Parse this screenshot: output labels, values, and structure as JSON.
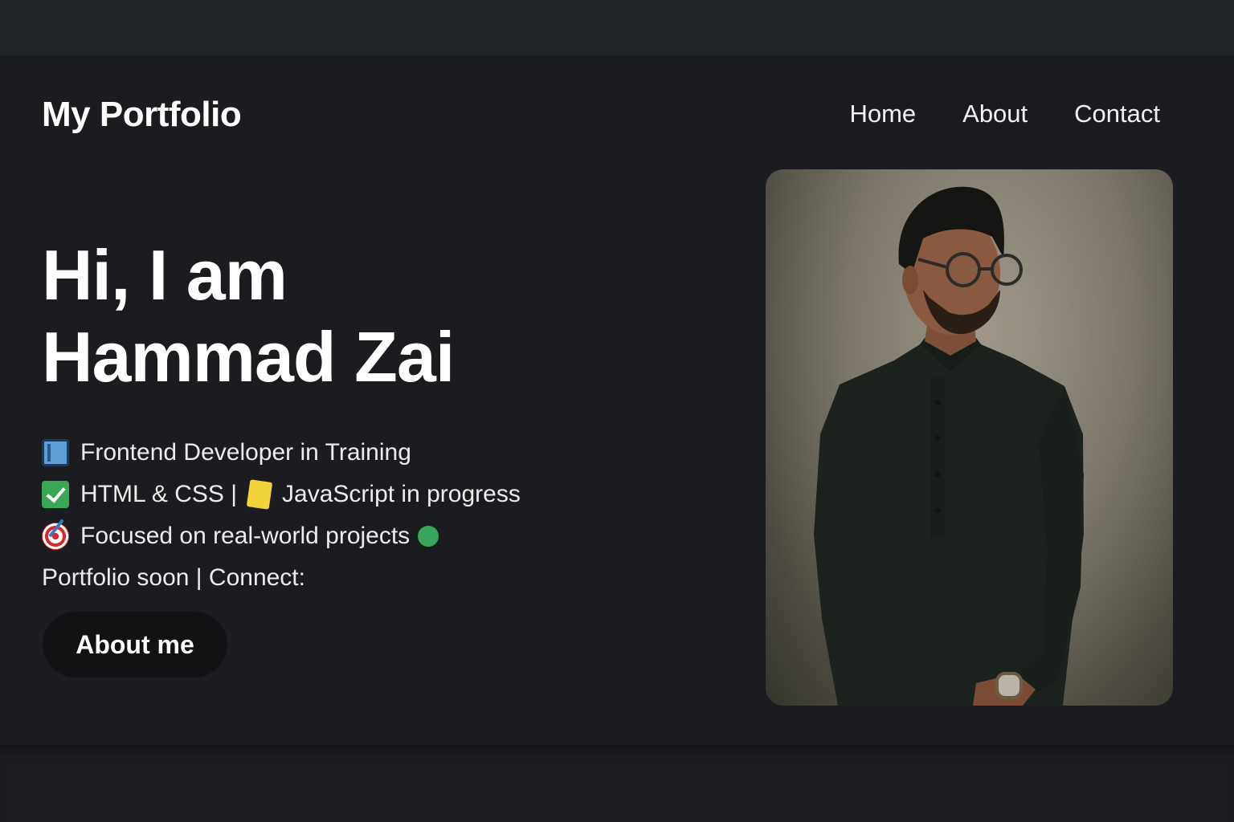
{
  "header": {
    "brand": "My Portfolio",
    "nav": [
      "Home",
      "About",
      "Contact"
    ]
  },
  "hero": {
    "title_line1": "Hi, I am",
    "title_line2": "Hammad Zai",
    "bullets": [
      {
        "icon": "book-icon",
        "text": "Frontend Developer in Training"
      },
      {
        "icon": "check-mark-icon",
        "text_before": "HTML & CSS |",
        "icon2": "javascript-icon",
        "text_after": "JavaScript in progress"
      },
      {
        "icon": "target-icon",
        "text": "Focused on real-world projects",
        "icon_after": "green-circle-icon"
      }
    ],
    "connect_line": "Portfolio soon | Connect:",
    "cta_label": "About me"
  },
  "photo": {
    "subject": "man in dark kurta with glasses",
    "icon": "profile-photo"
  },
  "colors": {
    "background": "#1b1c1f",
    "text": "#ffffff",
    "button_bg": "#111214"
  }
}
